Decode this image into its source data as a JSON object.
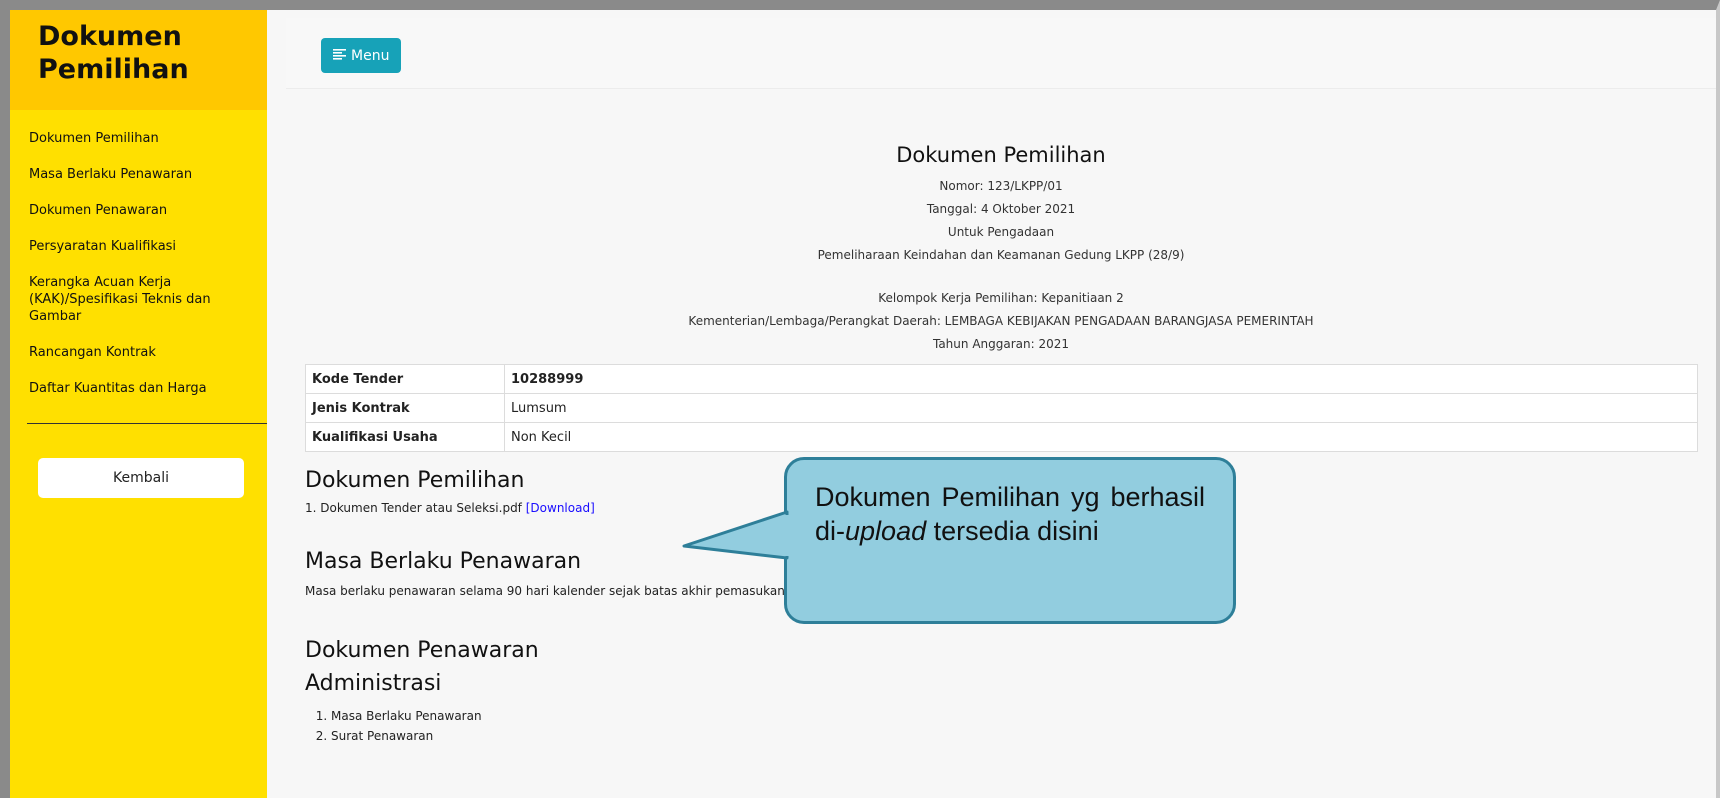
{
  "sidebar": {
    "title": "Dokumen\nPemilihan",
    "items": [
      {
        "label": "Dokumen Pemilihan"
      },
      {
        "label": "Masa Berlaku Penawaran"
      },
      {
        "label": "Dokumen Penawaran"
      },
      {
        "label": "Persyaratan Kualifikasi"
      },
      {
        "label": "Kerangka Acuan Kerja (KAK)/Spesifikasi Teknis dan Gambar"
      },
      {
        "label": "Rancangan Kontrak"
      },
      {
        "label": "Daftar Kuantitas dan Harga"
      }
    ],
    "back_label": "Kembali"
  },
  "topbar": {
    "menu_label": "Menu",
    "menu_icon": "menu-icon"
  },
  "document": {
    "title": "Dokumen Pemilihan",
    "nomor": "Nomor: 123/LKPP/01",
    "tanggal": "Tanggal: 4 Oktober 2021",
    "untuk": "Untuk Pengadaan",
    "pengadaan": "Pemeliharaan Keindahan dan Keamanan Gedung LKPP (28/9)",
    "kelompok": "Kelompok Kerja Pemilihan: Kepanitiaan 2",
    "kementerian": "Kementerian/Lembaga/Perangkat Daerah: LEMBAGA KEBIJAKAN PENGADAAN BARANGJASA PEMERINTAH",
    "tahun": "Tahun Anggaran: 2021"
  },
  "info_table": {
    "rows": [
      {
        "label": "Kode Tender",
        "value": "10288999"
      },
      {
        "label": "Jenis Kontrak",
        "value": "Lumsum"
      },
      {
        "label": "Kualifikasi Usaha",
        "value": "Non Kecil"
      }
    ]
  },
  "sections": {
    "dokumen_pemilihan": {
      "heading": "Dokumen Pemilihan",
      "file": "1. Dokumen Tender atau Seleksi.pdf",
      "download_label": "[Download]"
    },
    "masa_berlaku": {
      "heading": "Masa Berlaku Penawaran",
      "text": "Masa berlaku penawaran selama 90 hari kalender sejak batas akhir pemasukan dokumen penawaran"
    },
    "dokumen_penawaran": {
      "heading": "Dokumen Penawaran"
    },
    "administrasi": {
      "heading": "Administrasi",
      "items": [
        "Masa Berlaku Penawaran",
        "Surat Penawaran"
      ]
    }
  },
  "callout": {
    "text_before": "Dokumen Pemilihan yg berhasil di-",
    "text_italic": "upload",
    "text_after": " tersedia disini"
  },
  "colors": {
    "sidebar_bg": "#ffe000",
    "sidebar_header_bg": "#ffc800",
    "menu_button_bg": "#17a2b8",
    "link": "#1a0dff",
    "callout_fill": "#92cddf",
    "callout_border": "#2e7f99"
  }
}
